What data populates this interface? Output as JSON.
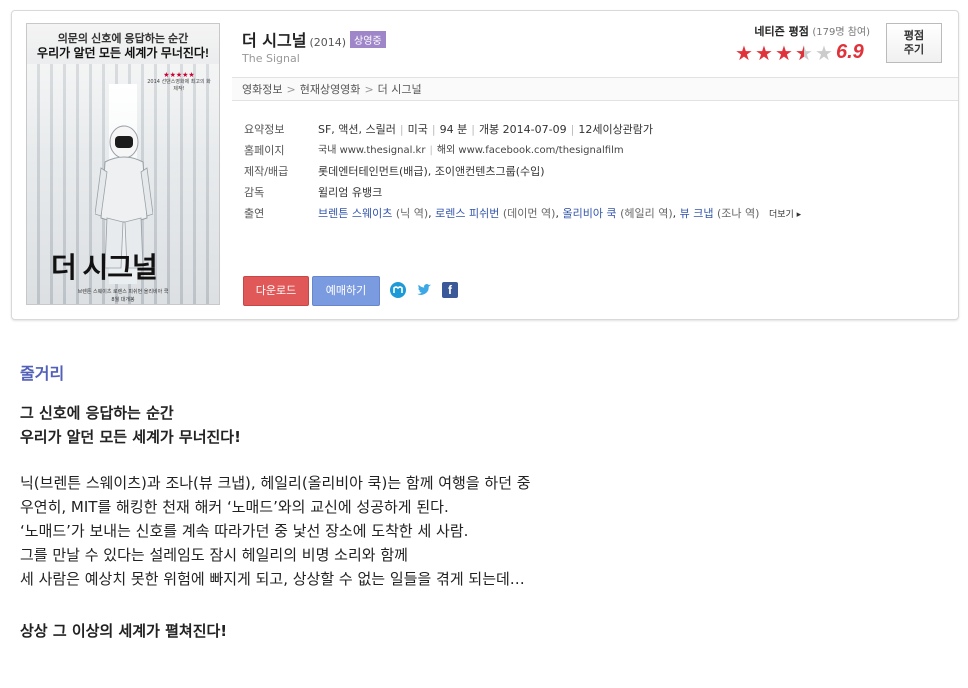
{
  "movie": {
    "title": "더 시그널",
    "year": "(2014)",
    "status_badge": "상영중",
    "english_title": "The Signal"
  },
  "poster": {
    "tagline_1": "의문의 신호에 응답하는 순간",
    "tagline_2": "우리가 알던 모든 세계가 무너진다!",
    "review_text": "2014 선댄스영화제 최고의 화제작!",
    "review_stars": "★★★★★",
    "title_text": "더 시그널",
    "credits_1": "브렌튼 스웨이츠 로렌스 피쉬번 올리비아 쿡",
    "credits_2": "8월 대개봉"
  },
  "rating": {
    "label": "네티즌 평점",
    "participants": "(179명 참여)",
    "score": "6.9",
    "stars_value": 3.45,
    "stars_max": 5,
    "rate_button": "평점\n주기"
  },
  "breadcrumb": [
    "영화정보",
    "현재상영영화",
    "더 시그널"
  ],
  "info": {
    "summary_label": "요약정보",
    "summary_parts": [
      "SF, 액션, 스릴러",
      "미국",
      "94 분",
      "개봉 2014-07-09",
      "12세이상관람가"
    ],
    "homepage_label": "홈페이지",
    "homepage_domestic": "국내 www.thesignal.kr",
    "homepage_overseas": "해외 www.facebook.com/thesignalfilm",
    "production_label": "제작/배급",
    "production_value": "롯데엔터테인먼트(배급), 조이앤컨텐츠그룹(수입)",
    "director_label": "감독",
    "director_value": "윌리엄 유뱅크",
    "cast_label": "출연",
    "cast": [
      {
        "name": "브렌튼 스웨이츠",
        "role": "(닉 역)"
      },
      {
        "name": "로렌스 피쉬번",
        "role": "(데이먼 역)"
      },
      {
        "name": "올리비아 쿡",
        "role": "(헤일리 역)"
      },
      {
        "name": "뷰 크냅",
        "role": "(조나 역)"
      }
    ],
    "more_label": "더보기 ▸"
  },
  "buttons": {
    "download": "다운로드",
    "reserve": "예매하기"
  },
  "synopsis": {
    "title": "줄거리",
    "headline_1": "그 신호에 응답하는 순간",
    "headline_2": "우리가 알던 모든 세계가 무너진다!",
    "body": [
      "닉(브렌튼 스웨이츠)과 조나(뷰 크냅), 헤일리(올리비아 쿡)는 함께 여행을 하던 중",
      "우연히, MIT를 해킹한 천재 해커 ‘노매드’와의 교신에 성공하게 된다.",
      "‘노매드’가 보내는 신호를 계속 따라가던 중 낯선 장소에 도착한 세 사람.",
      "그를 만날 수 있다는 설레임도 잠시 헤일리의 비명 소리와 함께",
      "세 사람은 예상치 못한 위험에 빠지게 되고, 상상할 수 없는 일들을 겪게 되는데…"
    ],
    "closing": "상상 그 이상의 세계가 펼쳐진다!"
  }
}
